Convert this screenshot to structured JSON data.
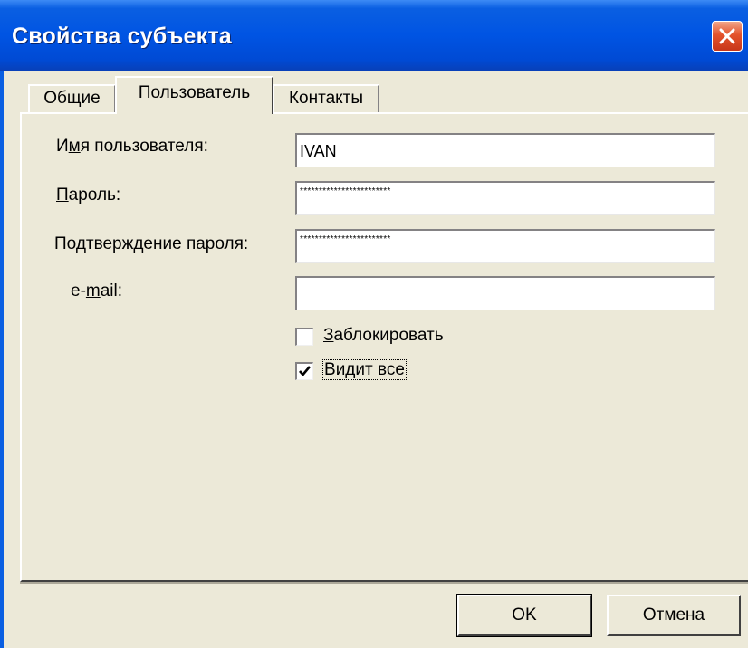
{
  "window": {
    "title": "Свойства субъекта"
  },
  "tabs": [
    {
      "label": "Общие",
      "active": false
    },
    {
      "label": "Пользователь",
      "active": true
    },
    {
      "label": "Контакты",
      "active": false
    }
  ],
  "form": {
    "username": {
      "label_pre": "И",
      "label_access": "м",
      "label_post": "я пользователя:",
      "value": "IVAN"
    },
    "password": {
      "label_access": "П",
      "label_post": "ароль:",
      "value": "************************"
    },
    "confirm": {
      "label_pre": "По",
      "label_access": "д",
      "label_post": "тверждение пароля:",
      "value": "************************"
    },
    "email": {
      "label_pre": "e-",
      "label_access": "m",
      "label_post": "ail:",
      "value": ""
    }
  },
  "options": {
    "block": {
      "label_access": "З",
      "label_post": "аблокировать",
      "checked": false
    },
    "see_all": {
      "label_access": "В",
      "label_post": "идит все",
      "checked": true
    }
  },
  "buttons": {
    "ok": "OK",
    "cancel": "Отмена"
  },
  "colors": {
    "titlebar": "#0054e3",
    "face": "#ece9d8",
    "close": "#e4532b"
  },
  "icons": {
    "close": "close-icon",
    "checkmark": "checkmark-icon"
  }
}
